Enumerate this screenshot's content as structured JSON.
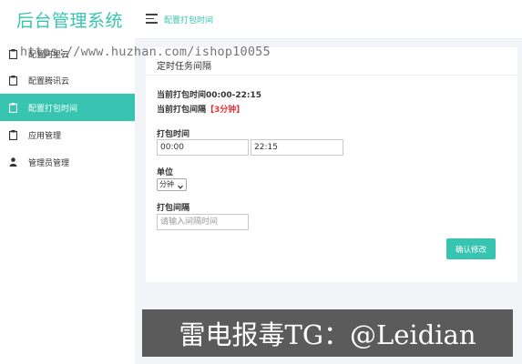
{
  "app": {
    "logo": "后台管理系统"
  },
  "sidebar": {
    "items": [
      {
        "label": "配置阿里云",
        "icon": "clipboard-icon"
      },
      {
        "label": "配置腾讯云",
        "icon": "clipboard-icon"
      },
      {
        "label": "配置打包时间",
        "icon": "clipboard-icon",
        "active": true
      },
      {
        "label": "应用管理",
        "icon": "clipboard-icon"
      },
      {
        "label": "管理员管理",
        "icon": "user-icon"
      }
    ]
  },
  "header": {
    "title": "配置打包时间"
  },
  "watermark": {
    "text": "https://www.huzhan.com/ishop10055"
  },
  "card": {
    "title": "定时任务间隔",
    "current_time": "当前打包时间00:00-22:15",
    "interval_prefix": "当前打包间隔",
    "interval_value": "【3分钟】",
    "pack_time_label": "打包时间",
    "start_value": "00:00",
    "end_value": "22:15",
    "unit_label": "单位",
    "unit_selected": "分钟",
    "interval_label": "打包间隔",
    "interval_placeholder": "请输入间隔时间",
    "submit_label": "确认修改"
  },
  "banner": {
    "text": "雷电报毒TG：@Leidian"
  },
  "colors": {
    "accent": "#37c4b0",
    "highlight": "#e8343c",
    "banner_bg": "#5b5b5b"
  }
}
